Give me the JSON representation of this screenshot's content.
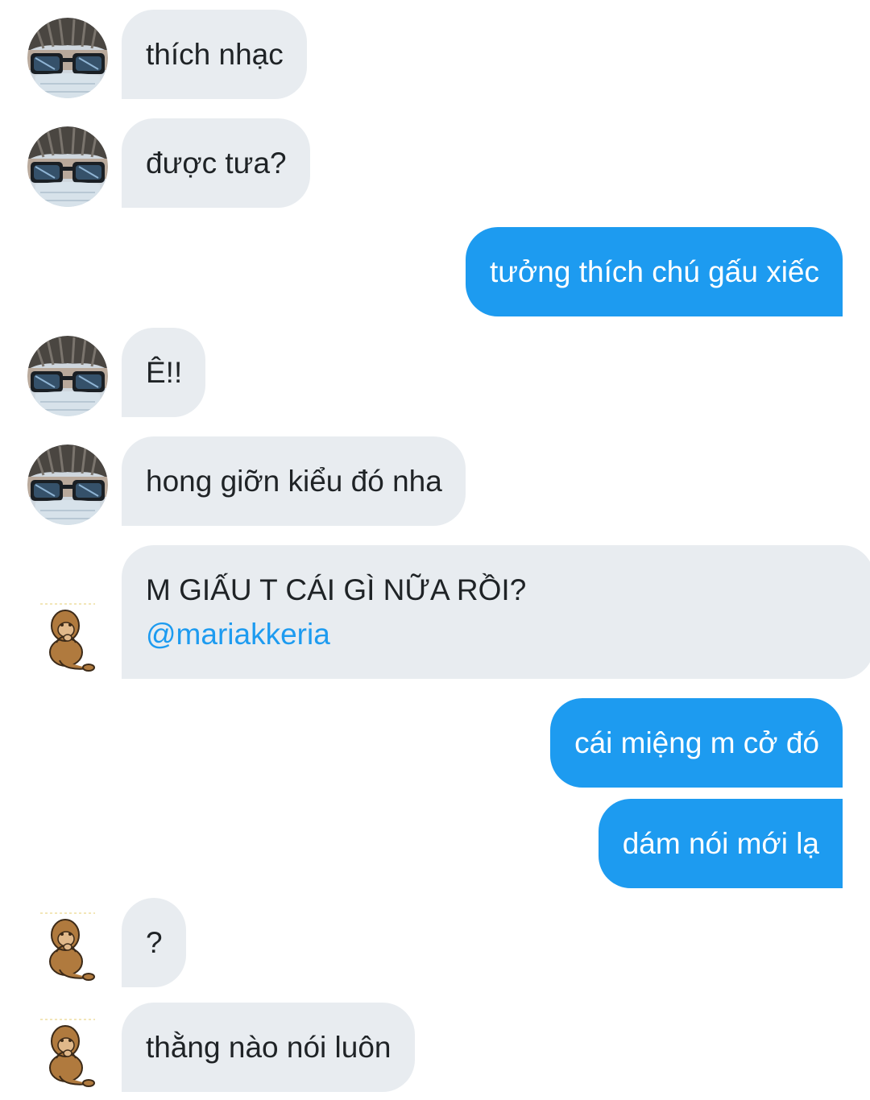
{
  "messages": [
    {
      "text": "thích nhạc"
    },
    {
      "text": "được tưa?"
    },
    {
      "text": "tưởng thích chú gấu xiếc"
    },
    {
      "text": "Ê!!"
    },
    {
      "text": "hong giỡn kiểu đó nha"
    },
    {
      "text": "M GIẤU T CÁI GÌ NỮA RỒI?",
      "mention": "@mariakkeria"
    },
    {
      "text": "cái miệng m cở đó"
    },
    {
      "text": "dám nói mới lạ"
    },
    {
      "text": "?"
    },
    {
      "text": "thằng nào nói luôn"
    }
  ],
  "colors": {
    "incoming_bubble": "#e8ecf0",
    "outgoing_bubble": "#1d9bf0",
    "mention": "#1d9bf0"
  },
  "icons": {
    "avatar_a": "person-sunglasses-avatar",
    "avatar_b": "sitting-animal-avatar"
  }
}
